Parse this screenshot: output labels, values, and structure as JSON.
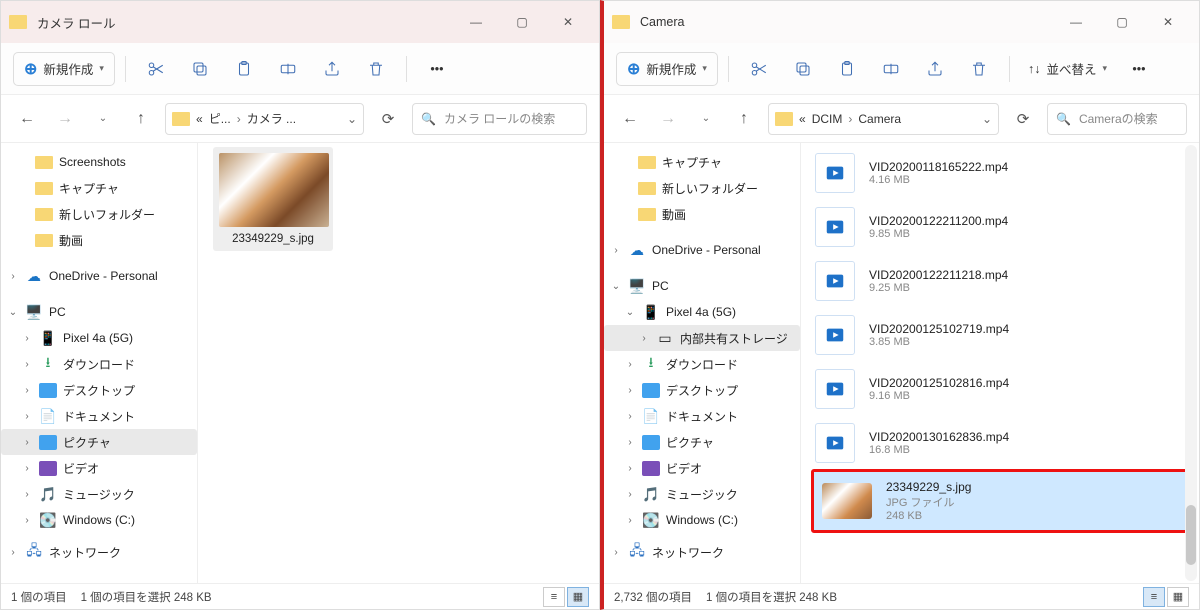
{
  "left": {
    "title": "カメラ ロール",
    "new_label": "新規作成",
    "breadcrumbs": [
      "«",
      "ピ...",
      "カメラ ..."
    ],
    "search_placeholder": "カメラ ロールの検索",
    "nav_folders": [
      "Screenshots",
      "キャプチャ",
      "新しいフォルダー",
      "動画"
    ],
    "nav_onedrive": "OneDrive - Personal",
    "nav_pc": "PC",
    "nav_pc_items": [
      "Pixel 4a (5G)",
      "ダウンロード",
      "デスクトップ",
      "ドキュメント",
      "ピクチャ",
      "ビデオ",
      "ミュージック",
      "Windows (C:)"
    ],
    "nav_network": "ネットワーク",
    "thumb_name": "23349229_s.jpg",
    "status_items": "1 個の項目",
    "status_sel": "1 個の項目を選択 248 KB"
  },
  "right": {
    "title": "Camera",
    "new_label": "新規作成",
    "sort_label": "並べ替え",
    "breadcrumbs": [
      "«",
      "DCIM",
      "Camera"
    ],
    "search_placeholder": "Cameraの検索",
    "nav_folders": [
      "キャプチャ",
      "新しいフォルダー",
      "動画"
    ],
    "nav_onedrive": "OneDrive - Personal",
    "nav_pc": "PC",
    "nav_pixel": "Pixel 4a (5G)",
    "nav_storage": "内部共有ストレージ",
    "nav_pc_items": [
      "ダウンロード",
      "デスクトップ",
      "ドキュメント",
      "ピクチャ",
      "ビデオ",
      "ミュージック",
      "Windows (C:)"
    ],
    "nav_network": "ネットワーク",
    "files": [
      {
        "n": "VID20200118165222.mp4",
        "s": "4.16 MB"
      },
      {
        "n": "VID20200122211200.mp4",
        "s": "9.85 MB"
      },
      {
        "n": "VID20200122211218.mp4",
        "s": "9.25 MB"
      },
      {
        "n": "VID20200125102719.mp4",
        "s": "3.85 MB"
      },
      {
        "n": "VID20200125102816.mp4",
        "s": "9.16 MB"
      },
      {
        "n": "VID20200130162836.mp4",
        "s": "16.8 MB"
      }
    ],
    "sel_file": {
      "n": "23349229_s.jpg",
      "t": "JPG ファイル",
      "s": "248 KB"
    },
    "status_items": "2,732 個の項目",
    "status_sel": "1 個の項目を選択 248 KB"
  }
}
